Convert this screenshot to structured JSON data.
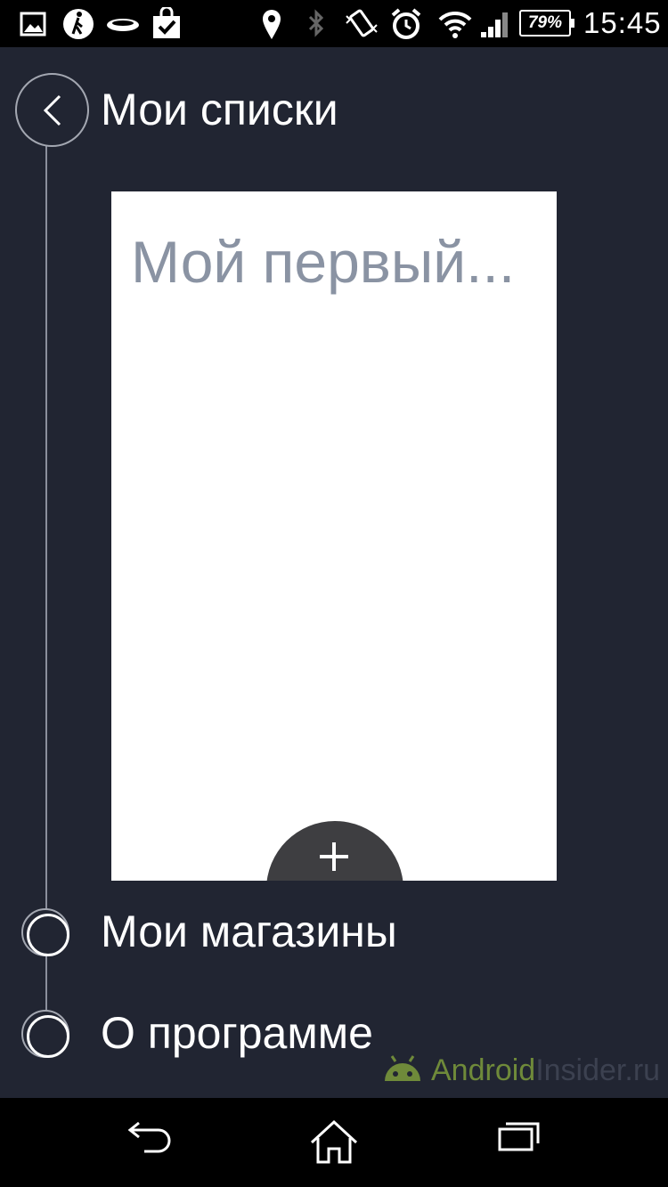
{
  "status_bar": {
    "icons": [
      "image-icon",
      "walking-icon",
      "wearable-icon",
      "shopping-bag-check-icon",
      "location-pin-icon",
      "bluetooth-icon",
      "vibrate-icon",
      "alarm-icon",
      "wifi-icon",
      "signal-icon"
    ],
    "battery": "79%",
    "time": "15:45"
  },
  "header": {
    "title": "Мои списки"
  },
  "list_card": {
    "title": "Мой первый..."
  },
  "nav_items": [
    {
      "label": "Мои магазины"
    },
    {
      "label": "О программе"
    }
  ],
  "watermark": {
    "part1": "Android",
    "part2": "Insider.ru"
  },
  "system_nav": {
    "icons": [
      "back-icon",
      "home-icon",
      "recent-apps-icon"
    ]
  },
  "colors": {
    "background": "#212532",
    "card": "#ffffff",
    "card_title": "#8a93a3",
    "fab": "#3e3e41",
    "accent_green": "#6f8a3a"
  }
}
